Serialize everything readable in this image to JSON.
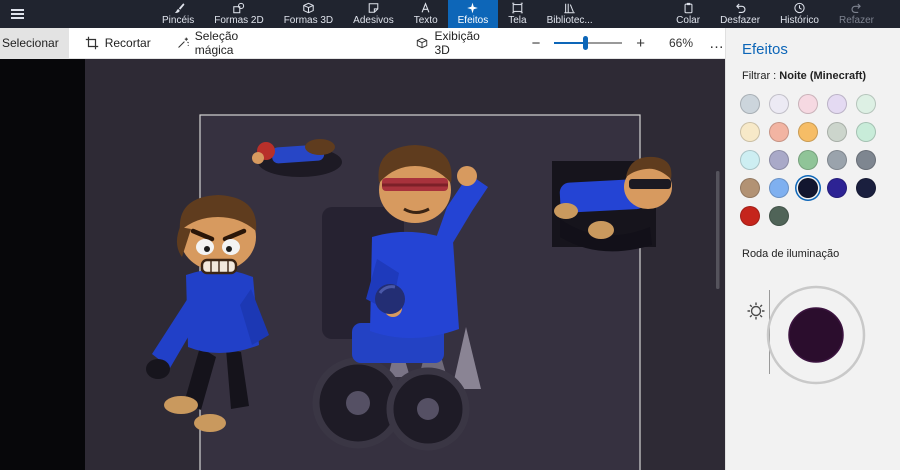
{
  "colors": {
    "accent": "#0d66b8",
    "topbar_bg": "#20242f",
    "panel_bg": "#f2f2f2",
    "canvas_bg": "#07070a",
    "viewport_bg": "#2e2a35",
    "frame_fill": "#363140",
    "frame_border": "#d4d4d4"
  },
  "topbar": {
    "tabs": [
      "Pincéis",
      "Formas 2D",
      "Formas 3D",
      "Adesivos",
      "Texto",
      "Efeitos",
      "Tela",
      "Bibliotec..."
    ],
    "actions": [
      "Colar",
      "Desfazer",
      "Histórico",
      "Refazer"
    ]
  },
  "toolbar": {
    "select_label": "Selecionar",
    "crop_label": "Recortar",
    "magic_label": "Seleção mágica",
    "view3d_label": "Exibição 3D",
    "zoom_minus": "−",
    "zoom_plus": "+",
    "zoom_value": "66%",
    "more_label": "…"
  },
  "panel": {
    "title": "Efeitos",
    "filter_label": "Filtrar :",
    "filter_value": "Noite (Minecraft)",
    "lighting_label": "Roda de iluminação",
    "wheel_fill": "#2b0d2d",
    "swatches": [
      {
        "color": "#ccd5dc"
      },
      {
        "color": "#eceaf4"
      },
      {
        "color": "#f6d9e2"
      },
      {
        "color": "#e4daf2"
      },
      {
        "color": "#ddf0e4"
      },
      {
        "color": "#f7e9c8"
      },
      {
        "color": "#f2b4a2"
      },
      {
        "color": "#f6bd66"
      },
      {
        "color": "#ccd5cc"
      },
      {
        "color": "#c8ecd9"
      },
      {
        "color": "#cdeef2"
      },
      {
        "color": "#a9a9c8"
      },
      {
        "color": "#90c498"
      },
      {
        "color": "#9aa3ac"
      },
      {
        "color": "#7e8690"
      },
      {
        "color": "#b29274"
      },
      {
        "color": "#7fb0f0"
      },
      {
        "color": "#12162f",
        "selected": true
      },
      {
        "color": "#2d2394"
      },
      {
        "color": "#1a1f3e"
      },
      {
        "color": "#c5251c"
      },
      {
        "color": "#506458"
      }
    ]
  }
}
